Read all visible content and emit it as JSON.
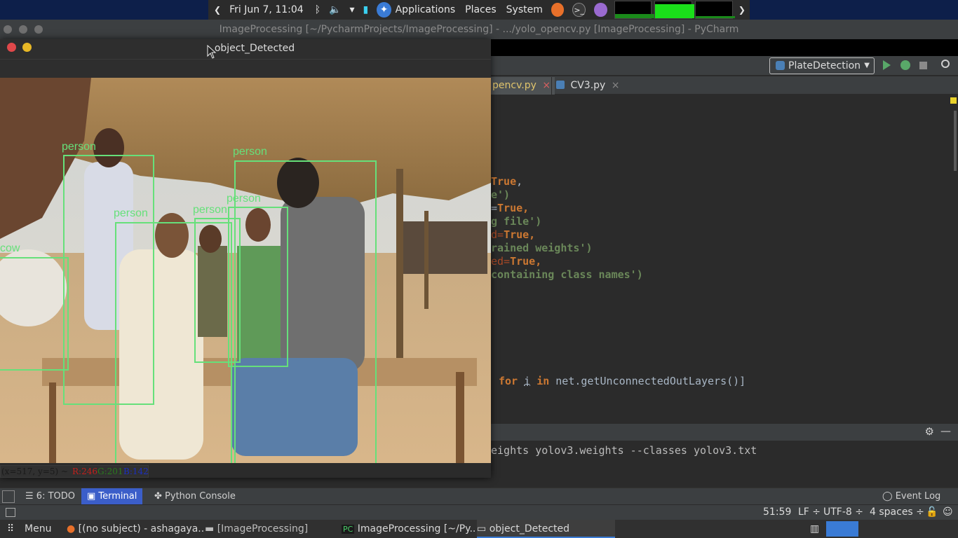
{
  "top_panel": {
    "datetime": "Fri Jun 7, 11:04",
    "applications": "Applications",
    "places": "Places",
    "system": "System"
  },
  "pycharm": {
    "title": "ImageProcessing [~/PycharmProjects/ImageProcessing] - .../yolo_opencv.py [ImageProcessing] - PyCharm",
    "run_config": "PlateDetection",
    "tabs": [
      {
        "label": "pencv.py"
      },
      {
        "label": "CV3.py"
      }
    ],
    "code_lines": [
      {
        "a": "True",
        "b": ","
      },
      {
        "a": "e')",
        "b": ""
      },
      {
        "a": "=",
        "b": "True,"
      },
      {
        "a": "g file')",
        "b": ""
      },
      {
        "a": "d=",
        "b": "True,"
      },
      {
        "a": "rained weights')",
        "b": ""
      },
      {
        "a": "ed=",
        "b": "True,"
      },
      {
        "a": "containing class names')",
        "b": ""
      }
    ],
    "code_loop": {
      "for": "for",
      "var": "i",
      "in": "in",
      "call": "net.getUnconnectedOutLayers()]"
    },
    "terminal_line": "eights yolov3.weights --classes yolov3.txt",
    "tool_windows": {
      "todo": "6: TODO",
      "terminal": "Terminal",
      "python_console": "Python Console",
      "event_log": "Event Log"
    },
    "status": {
      "position": "51:59",
      "line_sep": "LF ÷",
      "encoding": "UTF-8 ÷",
      "indent": "4 spaces ÷"
    }
  },
  "image_window": {
    "title": "object_Detected",
    "status_coords": "(x=517, y=5) ~",
    "status_r": "R:246",
    "status_g": "G:201",
    "status_b": "B:142",
    "detections": [
      "person",
      "person",
      "person",
      "person",
      "person",
      "cow"
    ]
  },
  "taskbar": {
    "menu": "Menu",
    "items": [
      {
        "label": "[(no subject) - ashagaya..."
      },
      {
        "label": "[ImageProcessing]"
      },
      {
        "label": "ImageProcessing [~/Py..."
      },
      {
        "label": "object_Detected"
      }
    ]
  },
  "colors": {
    "box": "#66e07a",
    "keyword": "#cc7832",
    "string": "#6a8759",
    "terminal_tab": "#3b5ec9"
  }
}
